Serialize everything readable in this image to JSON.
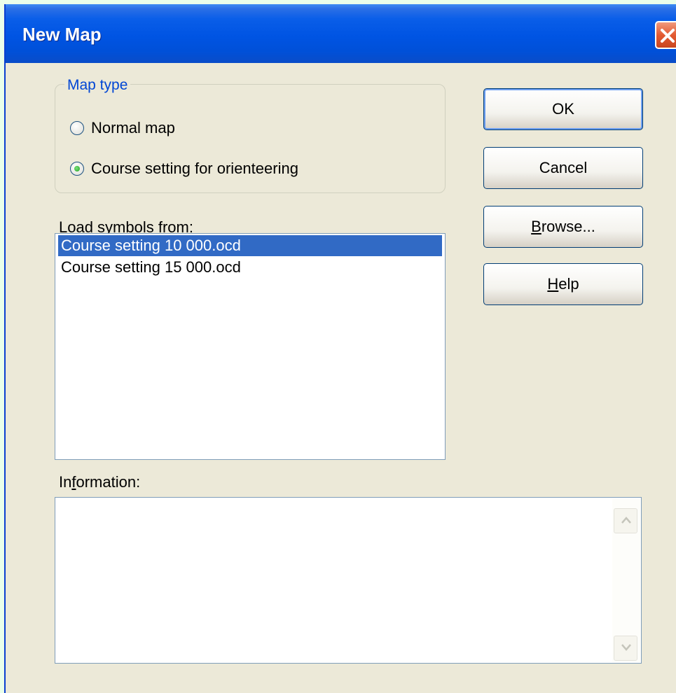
{
  "window": {
    "title": "New Map"
  },
  "map_type": {
    "label": "Map type",
    "options": [
      {
        "label": "Normal map",
        "selected": false
      },
      {
        "label": "Course setting for orienteering",
        "selected": true
      }
    ]
  },
  "symbols": {
    "label": "Load symbols from:",
    "items": [
      {
        "label": "Course setting 10 000.ocd",
        "selected": true
      },
      {
        "label": "Course setting 15 000.ocd",
        "selected": false
      }
    ]
  },
  "information": {
    "label_before": "In",
    "label_accel": "f",
    "label_after": "ormation:"
  },
  "buttons": {
    "ok": {
      "label": "OK"
    },
    "cancel": {
      "label": "Cancel"
    },
    "browse": {
      "accel": "B",
      "rest": "rowse..."
    },
    "help": {
      "accel": "H",
      "rest": "elp"
    }
  },
  "colors": {
    "title_bar": "#0054e3",
    "selection": "#316ac5",
    "group_title": "#0046d5"
  }
}
